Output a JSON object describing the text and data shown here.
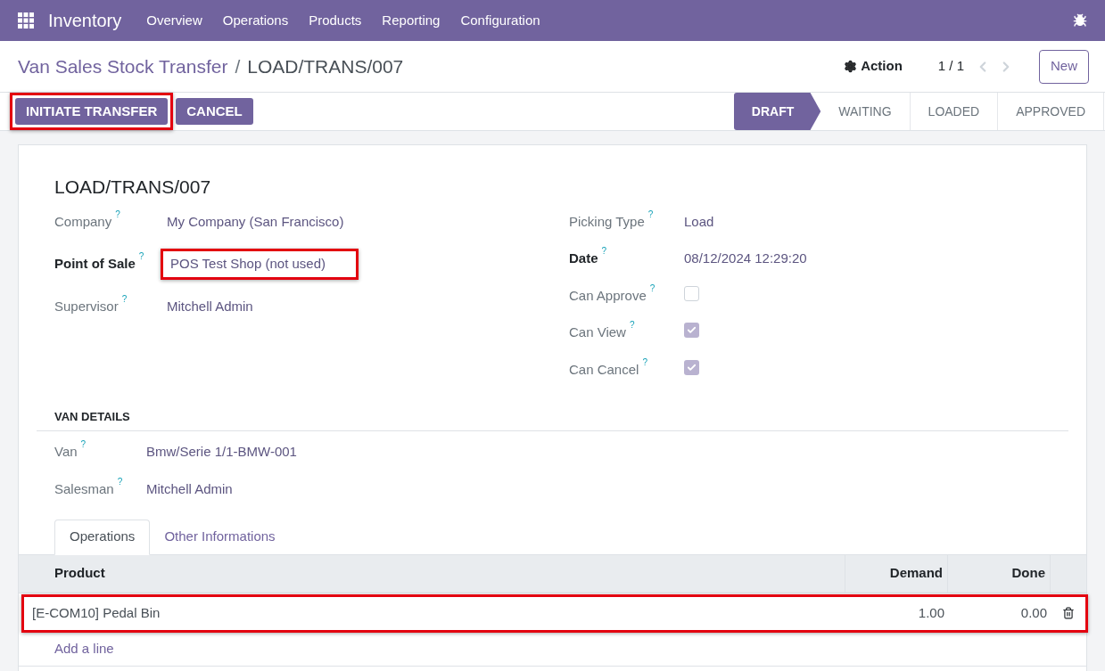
{
  "navbar": {
    "app": "Inventory",
    "menu": [
      "Overview",
      "Operations",
      "Products",
      "Reporting",
      "Configuration"
    ]
  },
  "breadcrumb": {
    "parent": "Van Sales Stock Transfer",
    "separator": "/",
    "current": "LOAD/TRANS/007"
  },
  "control_panel": {
    "action": "Action",
    "pager": "1 / 1",
    "new_button": "New"
  },
  "buttons": [
    {
      "label": "INITIATE TRANSFER",
      "highlighted": true
    },
    {
      "label": "CANCEL",
      "highlighted": false
    }
  ],
  "stages": [
    {
      "label": "DRAFT",
      "selected": true
    },
    {
      "label": "WAITING",
      "selected": false
    },
    {
      "label": "LOADED",
      "selected": false
    },
    {
      "label": "APPROVED",
      "selected": false
    }
  ],
  "sheet": {
    "title": "LOAD/TRANS/007",
    "left_fields": [
      {
        "kind": "text",
        "label": "Company",
        "help": "?",
        "value": "My Company (San Francisco)",
        "required": false,
        "highlighted": false
      },
      {
        "kind": "text",
        "label": "Point of Sale",
        "help": "?",
        "value": "POS Test Shop (not used)",
        "required": true,
        "highlighted": true
      },
      {
        "kind": "text",
        "label": "Supervisor",
        "help": "?",
        "value": "Mitchell Admin",
        "required": false,
        "highlighted": false
      }
    ],
    "right_fields": [
      {
        "kind": "text",
        "label": "Picking Type",
        "help": "?",
        "value": "Load",
        "required": false,
        "highlighted": false
      },
      {
        "kind": "text",
        "label": "Date",
        "help": "?",
        "value": "08/12/2024 12:29:20",
        "required": true,
        "highlighted": false
      },
      {
        "kind": "checkbox",
        "label": "Can Approve",
        "help": "?",
        "checked": false
      },
      {
        "kind": "checkbox",
        "label": "Can View",
        "help": "?",
        "checked": true
      },
      {
        "kind": "checkbox",
        "label": "Can Cancel",
        "help": "?",
        "checked": true
      }
    ],
    "van_details": {
      "title": "VAN DETAILS",
      "fields": [
        {
          "label": "Van",
          "help": "?",
          "value": "Bmw/Serie 1/1-BMW-001"
        },
        {
          "label": "Salesman",
          "help": "?",
          "value": "Mitchell Admin"
        }
      ]
    },
    "tabs": [
      {
        "label": "Operations",
        "selected": true
      },
      {
        "label": "Other Informations",
        "selected": false
      }
    ],
    "table": {
      "columns": [
        "Product",
        "Demand",
        "Done"
      ],
      "rows": [
        {
          "cells": [
            "[E-COM10] Pedal Bin",
            "1.00",
            "0.00"
          ],
          "highlighted": true
        }
      ],
      "add_line": "Add a line"
    }
  }
}
